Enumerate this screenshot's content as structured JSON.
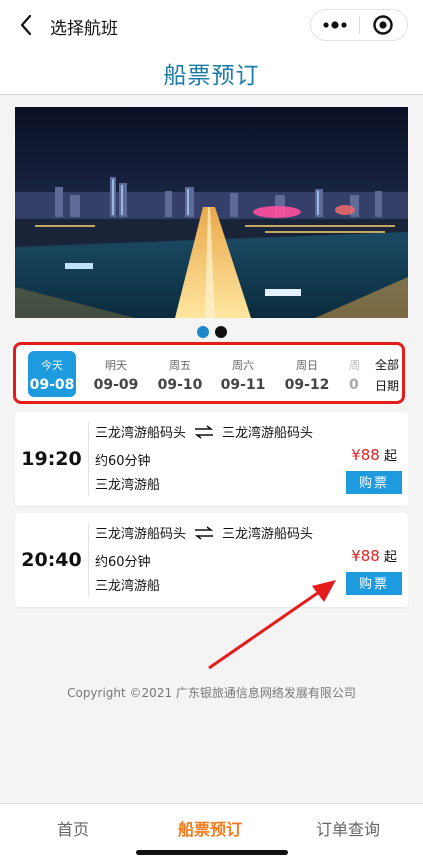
{
  "topbar": {
    "title": "选择航班"
  },
  "header": {
    "title": "船票预订"
  },
  "dates": [
    {
      "weekday": "今天",
      "date": "09-08",
      "selected": true
    },
    {
      "weekday": "明天",
      "date": "09-09"
    },
    {
      "weekday": "周五",
      "date": "09-10"
    },
    {
      "weekday": "周六",
      "date": "09-11"
    },
    {
      "weekday": "周日",
      "date": "09-12"
    },
    {
      "weekday": "周",
      "date": "0"
    }
  ],
  "all_dates": {
    "line1": "全部",
    "line2": "日期"
  },
  "trips": [
    {
      "time": "19:20",
      "from": "三龙湾游船码头",
      "to": "三龙湾游船码头",
      "duration": "约60分钟",
      "vessel": "三龙湾游船",
      "price": "¥88",
      "price_suffix": "起",
      "buy_label": "购票"
    },
    {
      "time": "20:40",
      "from": "三龙湾游船码头",
      "to": "三龙湾游船码头",
      "duration": "约60分钟",
      "vessel": "三龙湾游船",
      "price": "¥88",
      "price_suffix": "起",
      "buy_label": "购票"
    }
  ],
  "footer": {
    "copyright": "Copyright ©2021 广东银旅通信息网络发展有限公司"
  },
  "nav": [
    {
      "label": "首页"
    },
    {
      "label": "船票预订",
      "active": true
    },
    {
      "label": "订单查询"
    }
  ],
  "colors": {
    "accent": "#1e9bdf",
    "header_title": "#1a7ca8",
    "price": "#e02424",
    "highlight_frame": "#e51c1c",
    "nav_active": "#f07a1c"
  }
}
